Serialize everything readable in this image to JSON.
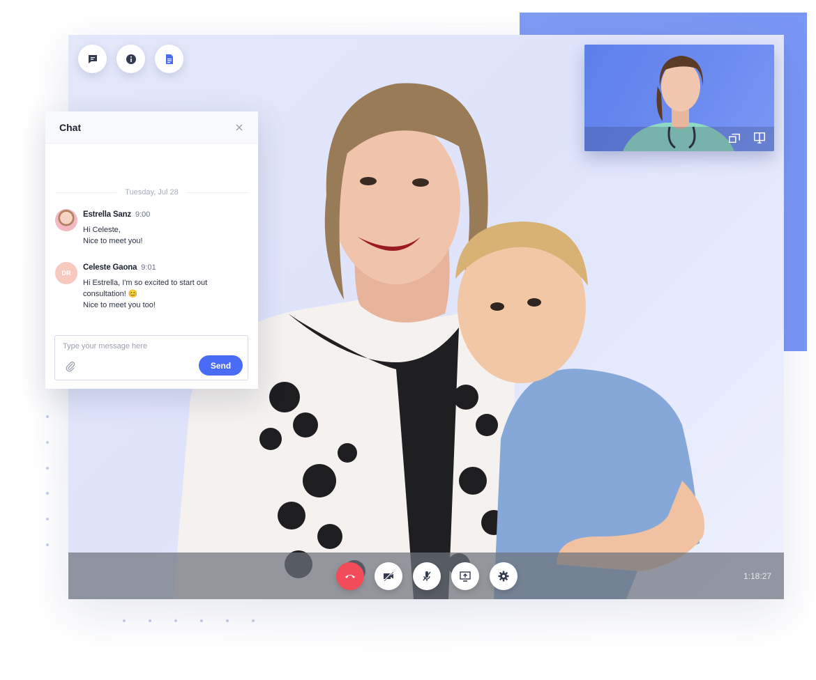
{
  "chat": {
    "title": "Chat",
    "date_separator": "Tuesday, Jul 28",
    "messages": [
      {
        "name": "Estrella Sanz",
        "time": "9:00",
        "lines": [
          "Hi Celeste,",
          "Nice to meet you!"
        ]
      },
      {
        "name": "Celeste Gaona",
        "time": "9:01",
        "initials": "DR",
        "lines": [
          "Hi Estrella, I'm so excited to start out",
          "consultation! 😊",
          "Nice to meet you too!"
        ]
      }
    ],
    "composer": {
      "placeholder": "Type your message here",
      "send_label": "Send"
    }
  },
  "call": {
    "timer": "1:18:27"
  },
  "colors": {
    "accent": "#4a6cf5",
    "end_call": "#f24c5a",
    "backdrop_blue": "#7a97f5"
  },
  "icons": {
    "top": [
      "chat-icon",
      "info-icon",
      "document-icon"
    ],
    "pip": [
      "swap-icon",
      "fullscreen-icon"
    ],
    "controls": [
      "end-call-icon",
      "camera-off-icon",
      "mic-off-icon",
      "share-screen-icon",
      "settings-icon"
    ]
  }
}
